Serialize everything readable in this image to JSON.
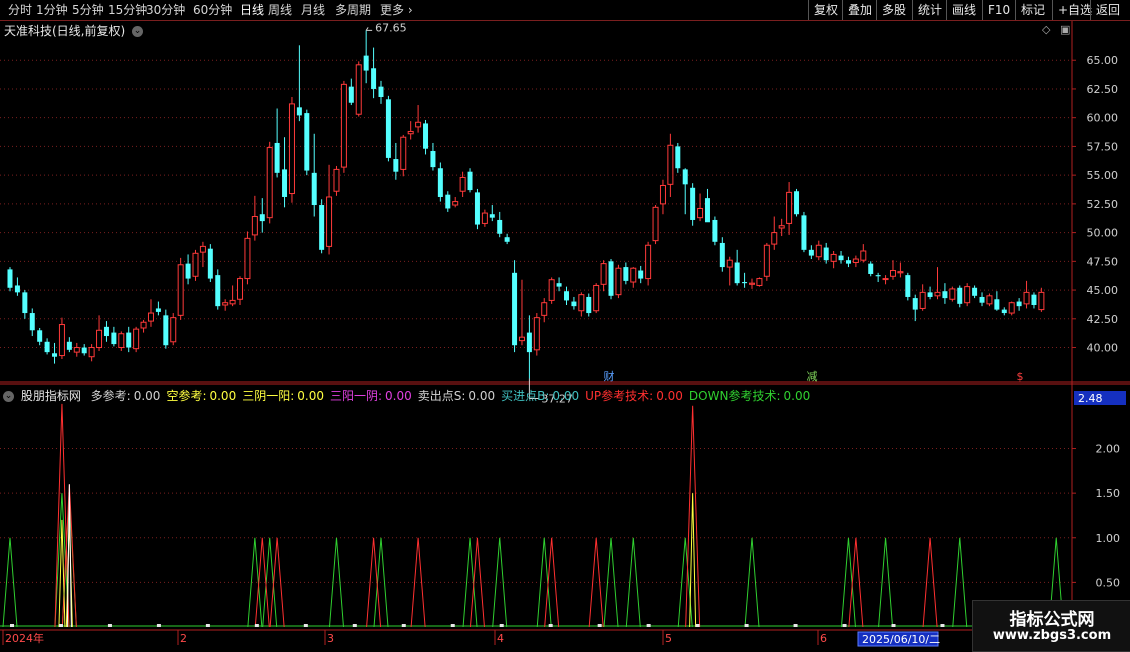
{
  "toolbar": {
    "left_tabs": [
      "分时",
      "1分钟",
      "5分钟",
      "15分钟",
      "30分钟",
      "60分钟",
      "日线",
      "周线",
      "月线",
      "多周期",
      "更多"
    ],
    "active_tab": "日线",
    "right_buttons": [
      "复权",
      "叠加",
      "多股",
      "统计",
      "画线",
      "F10",
      "标记",
      "+自选",
      "返回"
    ]
  },
  "main_panel": {
    "title": "天准科技(日线,前复权)",
    "high_label": "67.65",
    "low_label": "37.27",
    "event_markers": [
      {
        "text": "财",
        "color": "#5aa0ff"
      },
      {
        "text": "减",
        "color": "#7fd35a"
      },
      {
        "text": "$",
        "color": "#ff4040"
      }
    ],
    "y_ticks": [
      "65.00",
      "62.50",
      "60.00",
      "57.50",
      "55.00",
      "52.50",
      "50.00",
      "47.50",
      "45.00",
      "42.50",
      "40.00"
    ]
  },
  "indicator_panel": {
    "name": "股朋指标网",
    "fields": [
      {
        "label": "多参考:",
        "value": "0.00",
        "color": "#d0d0d0"
      },
      {
        "label": "空参考:",
        "value": "0.00",
        "color": "#ffff40"
      },
      {
        "label": "三阴一阳:",
        "value": "0.00",
        "color": "#ffff40"
      },
      {
        "label": "三阳一阴:",
        "value": "0.00",
        "color": "#e040e0"
      },
      {
        "label": "卖出点S:",
        "value": "0.00",
        "color": "#d0d0d0"
      },
      {
        "label": "买进点B:",
        "value": "0.00",
        "color": "#40c0c0"
      },
      {
        "label": "UP参考技术:",
        "value": "0.00",
        "color": "#ff3030"
      },
      {
        "label": "DOWN参考技术:",
        "value": "0.00",
        "color": "#30d030"
      }
    ],
    "current_value": "2.48",
    "y_ticks": [
      "2.00",
      "1.50",
      "1.00",
      "0.50"
    ]
  },
  "time_axis": {
    "labels": [
      "2024年",
      "2",
      "3",
      "4",
      "5",
      "6"
    ],
    "cursor_date": "2025/06/10/二"
  },
  "watermark": {
    "line1": "指标公式网",
    "line2": "www.zbgs3.com"
  },
  "colors": {
    "up": "#ff3a3a",
    "down": "#54ffff",
    "grid": "#7a1f1f",
    "axis": "#b02020"
  },
  "chart_data": {
    "type": "candlestick",
    "ylim": [
      37.0,
      68.5
    ],
    "ohlc": [
      [
        46.8,
        47.0,
        44.9,
        45.2
      ],
      [
        45.4,
        46.1,
        44.5,
        44.8
      ],
      [
        44.8,
        45.0,
        42.5,
        43.0
      ],
      [
        43.0,
        43.4,
        41.0,
        41.5
      ],
      [
        41.5,
        41.7,
        40.2,
        40.5
      ],
      [
        40.5,
        40.8,
        39.4,
        39.6
      ],
      [
        39.5,
        40.4,
        38.6,
        39.2
      ],
      [
        39.3,
        42.6,
        39.0,
        42.0
      ],
      [
        40.5,
        40.9,
        39.6,
        39.8
      ],
      [
        39.6,
        40.4,
        39.2,
        40.0
      ],
      [
        40.0,
        40.3,
        39.3,
        39.5
      ],
      [
        39.2,
        40.3,
        38.8,
        40.0
      ],
      [
        40.0,
        42.8,
        39.7,
        41.5
      ],
      [
        41.8,
        42.3,
        40.5,
        41.0
      ],
      [
        41.3,
        41.8,
        40.1,
        40.3
      ],
      [
        40.0,
        41.4,
        39.7,
        41.2
      ],
      [
        41.3,
        41.8,
        39.6,
        40.0
      ],
      [
        39.9,
        41.8,
        39.6,
        41.6
      ],
      [
        41.7,
        42.4,
        41.3,
        42.2
      ],
      [
        42.3,
        44.2,
        41.8,
        43.0
      ],
      [
        43.4,
        44.0,
        42.8,
        43.1
      ],
      [
        42.8,
        43.3,
        39.9,
        40.2
      ],
      [
        40.5,
        43.0,
        40.2,
        42.6
      ],
      [
        42.8,
        47.8,
        42.4,
        47.2
      ],
      [
        47.3,
        48.1,
        45.5,
        46.0
      ],
      [
        46.2,
        48.5,
        45.8,
        48.2
      ],
      [
        48.3,
        49.2,
        47.0,
        48.8
      ],
      [
        48.6,
        49.0,
        45.7,
        46.0
      ],
      [
        46.3,
        46.8,
        43.3,
        43.6
      ],
      [
        43.7,
        44.2,
        43.2,
        43.9
      ],
      [
        43.8,
        45.4,
        43.6,
        44.1
      ],
      [
        44.2,
        46.2,
        43.7,
        46.0
      ],
      [
        46.0,
        50.1,
        45.5,
        49.5
      ],
      [
        49.8,
        53.2,
        49.3,
        51.4
      ],
      [
        51.6,
        53.0,
        50.0,
        51.0
      ],
      [
        51.3,
        57.9,
        50.8,
        57.4
      ],
      [
        57.8,
        60.8,
        54.8,
        55.2
      ],
      [
        55.5,
        58.3,
        52.2,
        53.1
      ],
      [
        53.4,
        61.8,
        52.6,
        61.2
      ],
      [
        60.9,
        66.3,
        59.7,
        60.2
      ],
      [
        60.4,
        60.7,
        55.0,
        55.4
      ],
      [
        55.2,
        58.6,
        51.4,
        52.4
      ],
      [
        52.4,
        52.9,
        48.2,
        48.5
      ],
      [
        48.8,
        55.9,
        48.1,
        53.1
      ],
      [
        53.6,
        55.8,
        53.2,
        55.5
      ],
      [
        55.7,
        63.2,
        55.2,
        62.9
      ],
      [
        62.7,
        63.4,
        61.1,
        61.3
      ],
      [
        60.3,
        64.9,
        60.1,
        64.6
      ],
      [
        65.4,
        67.6,
        63.0,
        64.1
      ],
      [
        64.3,
        66.1,
        61.7,
        62.5
      ],
      [
        62.7,
        63.2,
        61.2,
        61.8
      ],
      [
        61.6,
        61.9,
        56.2,
        56.5
      ],
      [
        56.4,
        57.8,
        54.6,
        55.3
      ],
      [
        55.5,
        58.5,
        54.9,
        58.3
      ],
      [
        58.6,
        59.7,
        58.1,
        58.8
      ],
      [
        59.2,
        61.1,
        58.7,
        59.6
      ],
      [
        59.5,
        59.8,
        56.8,
        57.3
      ],
      [
        57.1,
        57.8,
        55.4,
        55.7
      ],
      [
        55.6,
        56.1,
        52.7,
        53.1
      ],
      [
        53.3,
        53.6,
        51.8,
        52.1
      ],
      [
        52.4,
        53.1,
        52.2,
        52.7
      ],
      [
        53.6,
        55.3,
        53.1,
        54.8
      ],
      [
        55.3,
        55.6,
        53.5,
        53.7
      ],
      [
        53.5,
        53.8,
        50.3,
        50.7
      ],
      [
        50.8,
        52.0,
        50.5,
        51.7
      ],
      [
        51.6,
        52.4,
        51.0,
        51.3
      ],
      [
        51.1,
        51.8,
        49.6,
        49.9
      ],
      [
        49.6,
        49.9,
        49.0,
        49.2
      ],
      [
        46.5,
        47.6,
        39.6,
        40.2
      ],
      [
        40.6,
        45.9,
        40.2,
        40.9
      ],
      [
        41.3,
        42.8,
        37.3,
        39.6
      ],
      [
        39.8,
        43.0,
        39.3,
        42.6
      ],
      [
        42.8,
        44.3,
        42.2,
        43.9
      ],
      [
        44.1,
        46.1,
        43.8,
        45.9
      ],
      [
        45.6,
        46.1,
        44.9,
        45.3
      ],
      [
        44.9,
        45.3,
        43.7,
        44.1
      ],
      [
        44.0,
        44.4,
        43.3,
        43.6
      ],
      [
        43.2,
        44.8,
        42.7,
        44.6
      ],
      [
        44.4,
        44.7,
        42.7,
        43.0
      ],
      [
        43.2,
        45.6,
        43.0,
        45.4
      ],
      [
        45.5,
        47.6,
        44.9,
        47.3
      ],
      [
        47.5,
        47.7,
        44.2,
        44.5
      ],
      [
        44.6,
        47.2,
        44.3,
        46.9
      ],
      [
        47.0,
        47.4,
        45.5,
        45.8
      ],
      [
        45.7,
        47.0,
        45.2,
        46.9
      ],
      [
        46.7,
        47.1,
        45.6,
        46.0
      ],
      [
        46.0,
        49.2,
        45.4,
        48.9
      ],
      [
        49.3,
        52.4,
        49.0,
        52.2
      ],
      [
        52.5,
        54.6,
        51.6,
        54.1
      ],
      [
        54.2,
        58.6,
        53.1,
        57.6
      ],
      [
        57.5,
        57.8,
        55.2,
        55.6
      ],
      [
        55.5,
        55.6,
        51.6,
        54.2
      ],
      [
        53.9,
        54.3,
        50.6,
        51.1
      ],
      [
        51.3,
        53.4,
        51.0,
        52.1
      ],
      [
        53.0,
        53.8,
        51.2,
        50.9
      ],
      [
        51.1,
        51.4,
        48.9,
        49.2
      ],
      [
        49.1,
        49.6,
        46.6,
        47.0
      ],
      [
        47.0,
        47.9,
        45.4,
        47.6
      ],
      [
        47.4,
        48.5,
        45.4,
        45.6
      ],
      [
        45.7,
        46.5,
        45.2,
        45.6
      ],
      [
        45.5,
        46.0,
        45.1,
        45.6
      ],
      [
        45.4,
        46.1,
        45.3,
        46.0
      ],
      [
        46.2,
        49.1,
        45.8,
        48.9
      ],
      [
        49.0,
        51.4,
        48.5,
        50.0
      ],
      [
        50.4,
        51.2,
        49.7,
        50.6
      ],
      [
        50.8,
        54.4,
        49.8,
        53.5
      ],
      [
        53.6,
        53.8,
        51.4,
        51.6
      ],
      [
        51.5,
        51.8,
        48.3,
        48.5
      ],
      [
        48.5,
        48.9,
        47.7,
        48.0
      ],
      [
        47.9,
        49.3,
        47.6,
        48.9
      ],
      [
        48.7,
        49.1,
        47.3,
        47.6
      ],
      [
        47.5,
        48.4,
        46.9,
        48.1
      ],
      [
        48.0,
        48.4,
        47.3,
        47.6
      ],
      [
        47.6,
        47.9,
        47.0,
        47.3
      ],
      [
        47.4,
        48.0,
        47.0,
        47.7
      ],
      [
        47.6,
        49.0,
        47.4,
        48.4
      ],
      [
        47.3,
        47.5,
        46.2,
        46.4
      ],
      [
        46.3,
        46.5,
        45.7,
        46.2
      ],
      [
        46.0,
        46.3,
        45.5,
        46.0
      ],
      [
        46.2,
        47.6,
        45.9,
        46.7
      ],
      [
        46.5,
        47.4,
        46.1,
        46.6
      ],
      [
        46.3,
        46.5,
        44.1,
        44.4
      ],
      [
        44.3,
        44.6,
        42.3,
        43.3
      ],
      [
        43.4,
        45.5,
        43.2,
        44.8
      ],
      [
        44.8,
        45.3,
        44.2,
        44.4
      ],
      [
        44.5,
        47.0,
        44.2,
        44.8
      ],
      [
        44.9,
        45.6,
        43.8,
        44.3
      ],
      [
        44.2,
        45.3,
        44.0,
        45.1
      ],
      [
        45.2,
        45.4,
        43.5,
        43.8
      ],
      [
        43.9,
        45.6,
        43.6,
        45.3
      ],
      [
        45.2,
        45.4,
        44.3,
        44.5
      ],
      [
        44.4,
        44.8,
        43.6,
        43.9
      ],
      [
        43.8,
        44.7,
        43.6,
        44.5
      ],
      [
        44.2,
        44.9,
        43.2,
        43.3
      ],
      [
        43.3,
        43.5,
        42.8,
        43.0
      ],
      [
        43.0,
        44.0,
        42.8,
        43.9
      ],
      [
        44.0,
        44.3,
        43.2,
        43.6
      ],
      [
        43.8,
        45.8,
        43.4,
        44.8
      ],
      [
        44.6,
        44.8,
        43.4,
        43.7
      ],
      [
        43.3,
        45.2,
        43.1,
        44.8
      ]
    ],
    "indicator": {
      "ylim": [
        0,
        2.6
      ],
      "green_spikes": [
        [
          0,
          1.0
        ],
        [
          7,
          1.5
        ],
        [
          8,
          1.5
        ],
        [
          33,
          1.0
        ],
        [
          35,
          1.0
        ],
        [
          44,
          1.0
        ],
        [
          50,
          1.0
        ],
        [
          62,
          1.0
        ],
        [
          66,
          1.0
        ],
        [
          72,
          1.0
        ],
        [
          81,
          1.0
        ],
        [
          84,
          1.0
        ],
        [
          91,
          1.0
        ],
        [
          100,
          1.0
        ],
        [
          113,
          1.0
        ],
        [
          118,
          1.0
        ],
        [
          128,
          1.0
        ],
        [
          141,
          1.0
        ]
      ],
      "red_spikes": [
        [
          7,
          2.5
        ],
        [
          8,
          1.6
        ],
        [
          34,
          1.0
        ],
        [
          36,
          1.0
        ],
        [
          49,
          1.0
        ],
        [
          55,
          1.0
        ],
        [
          63,
          1.0
        ],
        [
          73,
          1.0
        ],
        [
          79,
          1.0
        ],
        [
          92,
          2.48
        ],
        [
          114,
          1.0
        ],
        [
          124,
          1.0
        ]
      ],
      "yellow_spikes": [
        [
          7,
          1.2
        ],
        [
          8,
          1.2
        ],
        [
          92,
          1.5
        ]
      ],
      "white_spikes": [
        [
          8,
          1.6
        ]
      ]
    }
  }
}
